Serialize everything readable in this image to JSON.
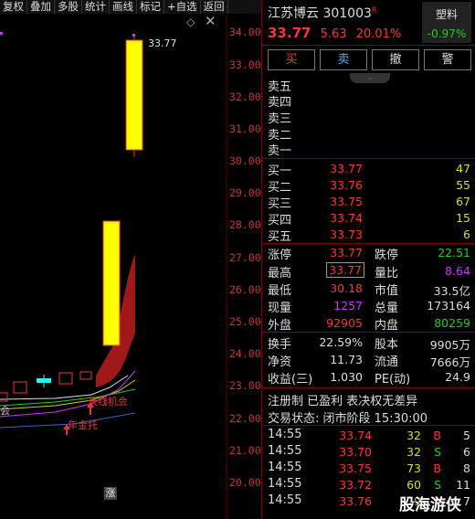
{
  "toolbar": [
    "复权",
    "叠加",
    "多股",
    "统计",
    "画线",
    "标记",
    "+自选",
    "返回"
  ],
  "chart": {
    "yticks": [
      "34.00",
      "33.00",
      "32.00",
      "31.00",
      "30.00",
      "29.00",
      "28.00",
      "27.00",
      "26.00",
      "25.00",
      "24.00",
      "23.00",
      "22.00",
      "21.00",
      "20.00"
    ],
    "high_label": "33.77",
    "annotations": {
      "ma_opportunity": "长线机会",
      "yearly_support": "年金托",
      "limit_up_marker": "涨",
      "left_mark": "会"
    }
  },
  "stock": {
    "name": "江苏博云 301003",
    "badge": "R",
    "price": "33.77",
    "change": "5.63",
    "pct": "20.01%",
    "sector": "塑料",
    "sector_pct": "-0.97%"
  },
  "buttons": {
    "buy": "买",
    "sell": "卖",
    "cancel": "撤",
    "alert": "警"
  },
  "sell_orders": [
    {
      "label": "卖五",
      "price": "",
      "vol": ""
    },
    {
      "label": "卖四",
      "price": "",
      "vol": ""
    },
    {
      "label": "卖三",
      "price": "",
      "vol": ""
    },
    {
      "label": "卖二",
      "price": "",
      "vol": ""
    },
    {
      "label": "卖一",
      "price": "",
      "vol": ""
    }
  ],
  "buy_orders": [
    {
      "label": "买一",
      "price": "33.77",
      "vol": "47"
    },
    {
      "label": "买二",
      "price": "33.76",
      "vol": "55"
    },
    {
      "label": "买三",
      "price": "33.75",
      "vol": "67"
    },
    {
      "label": "买四",
      "price": "33.74",
      "vol": "15"
    },
    {
      "label": "买五",
      "price": "33.73",
      "vol": "6"
    }
  ],
  "stats": {
    "limit_up_l": "涨停",
    "limit_up": "33.77",
    "limit_down_l": "跌停",
    "limit_down": "22.51",
    "high_l": "最高",
    "high": "33.77",
    "vol_ratio_l": "量比",
    "vol_ratio": "8.64",
    "low_l": "最低",
    "low": "30.18",
    "mcap_l": "市值",
    "mcap": "33.5亿",
    "cur_l": "现量",
    "cur": "1257",
    "total_l": "总量",
    "total": "173164",
    "outer_l": "外盘",
    "outer": "92905",
    "inner_l": "内盘",
    "inner": "80259",
    "turnover_l": "换手",
    "turnover": "22.59%",
    "equity_l": "股本",
    "equity": "9905万",
    "nav_l": "净资",
    "nav": "11.73",
    "float_l": "流通",
    "float": "7666万",
    "eps_l": "收益(三)",
    "eps": "1.030",
    "pe_l": "PE(动)",
    "pe": "24.9"
  },
  "info": {
    "line1": "注册制 已盈利 表决权无差异",
    "line2": "交易状态: 闭市阶段 15:30:00"
  },
  "trades": [
    {
      "t": "14:55",
      "p": "33.74",
      "v": "32",
      "d": "B",
      "n": "5"
    },
    {
      "t": "14:55",
      "p": "33.70",
      "v": "32",
      "d": "S",
      "n": "6"
    },
    {
      "t": "14:55",
      "p": "33.75",
      "v": "73",
      "d": "B",
      "n": "8"
    },
    {
      "t": "14:55",
      "p": "33.72",
      "v": "60",
      "d": "S",
      "n": "11"
    },
    {
      "t": "14:55",
      "p": "33.76",
      "v": "79",
      "d": "B",
      "n": "7"
    }
  ],
  "watermark": "股海游侠"
}
